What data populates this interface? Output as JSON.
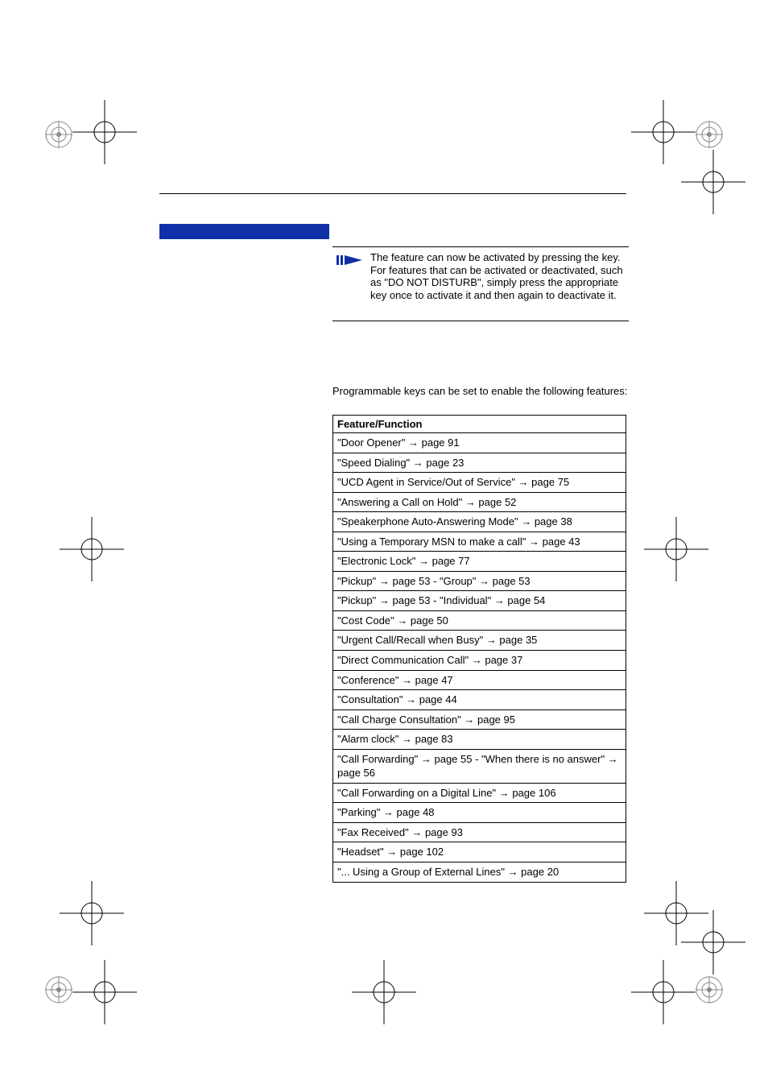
{
  "note": "The feature can now be activated by pressing the key. For features that can be activated or deactivated, such as \"DO NOT DISTURB\", simply press the appropriate key once to activate it and then again to deactivate it.",
  "intro": "Programmable keys can be set to enable the following features:",
  "table_header": "Feature/Function",
  "rows": [
    "\"Door Opener\" → page 91",
    "\"Speed Dialing\" → page 23",
    "\"UCD Agent in Service/Out of Service\" → page 75",
    "\"Answering a Call on Hold\" → page 52",
    "\"Speakerphone Auto-Answering Mode\" → page 38",
    "\"Using a Temporary MSN to make a call\" → page 43",
    "\"Electronic Lock\" → page 77",
    "\"Pickup\" → page 53 - \"Group\" → page 53",
    "\"Pickup\" → page 53 - \"Individual\" → page 54",
    "\"Cost Code\" → page 50",
    "\"Urgent Call/Recall when Busy\" → page 35",
    "\"Direct Communication Call\" → page 37",
    "\"Conference\" → page 47",
    "\"Consultation\" → page 44",
    "\"Call Charge Consultation\" → page 95",
    "\"Alarm clock\" → page 83",
    "\"Call Forwarding\" → page 55 - \"When there is no answer\" → page 56",
    "\"Call Forwarding on a Digital Line\" → page 106",
    "\"Parking\" → page 48",
    "\"Fax Received\" → page 93",
    "\"Headset\" → page 102",
    "\"... Using a Group of External Lines\" → page 20"
  ]
}
